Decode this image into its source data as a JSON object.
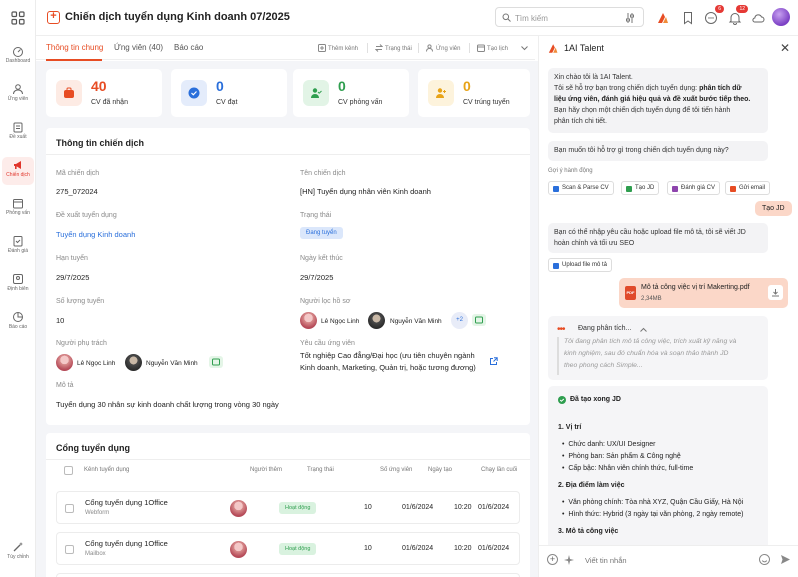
{
  "header": {
    "title": "Chiến dịch tuyển dụng Kinh doanh 07/2025",
    "search_placeholder": "Tìm kiếm",
    "notif_badge_1": "6",
    "notif_badge_2": "12"
  },
  "rail": {
    "items": [
      {
        "label": "Dashboard"
      },
      {
        "label": "Ứng viên"
      },
      {
        "label": "Đề xuất"
      },
      {
        "label": "Chiến dịch"
      },
      {
        "label": "Phỏng vấn"
      },
      {
        "label": "Đánh giá"
      },
      {
        "label": "Định biên"
      },
      {
        "label": "Báo cáo"
      },
      {
        "label": "Tùy chỉnh"
      }
    ]
  },
  "tabs": {
    "items": [
      "Thông tin chung",
      "Ứng viên  (40)",
      "Báo cáo"
    ],
    "actions": [
      "Thêm kênh",
      "Trạng thái",
      "Ứng viên",
      "Tạo lịch"
    ]
  },
  "stats": [
    {
      "value": "40",
      "label": "CV đã nhận",
      "color": "#e74c23"
    },
    {
      "value": "0",
      "label": "CV đạt",
      "color": "#2a6fdb"
    },
    {
      "value": "0",
      "label": "CV phỏng vấn",
      "color": "#2f9e4f"
    },
    {
      "value": "0",
      "label": "CV trúng tuyển",
      "color": "#e8a317"
    }
  ],
  "campaign": {
    "section_title": "Thông tin chiến dịch",
    "code_label": "Mã chiến dịch",
    "code": "275_072024",
    "name_label": "Tên chiến dịch",
    "name": "[HN] Tuyển dụng nhân viên Kinh doanh",
    "proposal_label": "Đề xuất tuyển dụng",
    "proposal": "Tuyển dụng Kinh doanh",
    "status_label": "Trạng thái",
    "status": "Đang tuyển",
    "deadline_label": "Hạn tuyển",
    "deadline": "29/7/2025",
    "end_label": "Ngày kết thúc",
    "end": "29/7/2025",
    "quantity_label": "Số lượng tuyển",
    "quantity": "10",
    "screener_label": "Người lọc hồ sơ",
    "screener_1": "Lê Ngọc Linh",
    "screener_2": "Nguyễn Văn Minh",
    "screener_more": "+2",
    "owner_label": "Người phụ trách",
    "owner_1": "Lê Ngọc Linh",
    "owner_2": "Nguyễn Văn Minh",
    "req_label": "Yêu cầu ứng viên",
    "req_line1": "Tốt nghiệp Cao đẳng/Đại học (ưu tiên chuyên ngành",
    "req_line2": "Kinh doanh, Marketing, Quản trị, hoặc tương đương)",
    "desc_label": "Mô tả",
    "desc": "Tuyển dụng 30 nhân sự kinh doanh chất lượng trong vòng 30 ngày"
  },
  "portals": {
    "section_title": "Cổng tuyển dụng",
    "columns": [
      "Kênh tuyển dụng",
      "Người thêm",
      "Trạng thái",
      "Số ứng viên",
      "Ngày tạo",
      "Chạy lần cuối"
    ],
    "rows": [
      {
        "name": "Cổng tuyển dụng 1Office",
        "source": "Webform",
        "status": "Hoạt động",
        "count": "10",
        "created": "01/6/2024",
        "time": "10:20",
        "last": "01/6/2024"
      },
      {
        "name": "Cổng tuyển dụng 1Office",
        "source": "Mailbox",
        "status": "Hoạt động",
        "count": "10",
        "created": "01/6/2024",
        "time": "10:20",
        "last": "01/6/2024"
      }
    ]
  },
  "chat": {
    "title": "1AI Talent",
    "greet_1": "Xin chào tôi là 1AI Talent.",
    "greet_2a": "Tôi sẽ hỗ trợ bạn trong chiến dịch tuyển dụng: ",
    "greet_2b": "phân tích dữ",
    "greet_3": "liệu ứng viên, đánh giá hiệu quả và đề xuất bước tiếp theo.",
    "greet_4": "Bạn hãy chọn một chiến dịch tuyển dụng để tôi tiến hành",
    "greet_5": "phân tích chi tiết.",
    "ask": "Bạn muốn tôi hỗ trợ gì trong chiến dịch tuyển dụng này?",
    "suggest_label": "Gợi ý hành động",
    "suggestions": [
      "Scan & Parse CV",
      "Tạo JD",
      "Đánh giá CV",
      "Gửi email"
    ],
    "user_msg": "Tạo JD",
    "bot_2a": "Bạn có thể nhập yêu cầu hoặc upload file mô tả, tôi sẽ viết JD",
    "bot_2b": "hoàn chỉnh và tối ưu SEO",
    "upload_btn": "Upload file mô tả",
    "file_name": "Mô tả công việc vị trí Makerting.pdf",
    "file_size": "2,34MB",
    "file_type": "PDF",
    "thinking_title": "Đang phân tích...",
    "thinking_1": "Tôi đang phân tích mô tả công việc, trích xuất kỹ năng và",
    "thinking_2": "kinh nghiệm, sau đó chuẩn hóa và soạn thảo thành JD",
    "thinking_3": "theo phong cách Simple...",
    "done": "Đã tạo xong JD",
    "s1": "1.  Vị trí",
    "s1a": "Chức danh: UX/UI Designer",
    "s1b": "Phòng ban: Sản phẩm & Công nghệ",
    "s1c": "Cấp bậc: Nhân viên chính thức, full-time",
    "s2": "2.  Địa điểm làm việc",
    "s2a": "Văn phòng chính: Tòa nhà XYZ, Quận Cầu Giấy, Hà Nội",
    "s2b": "Hình thức: Hybrid (3 ngày tại văn phòng, 2 ngày remote)",
    "s3": "3.  Mô tả công việc",
    "input_placeholder": "Viết tin nhắn"
  }
}
